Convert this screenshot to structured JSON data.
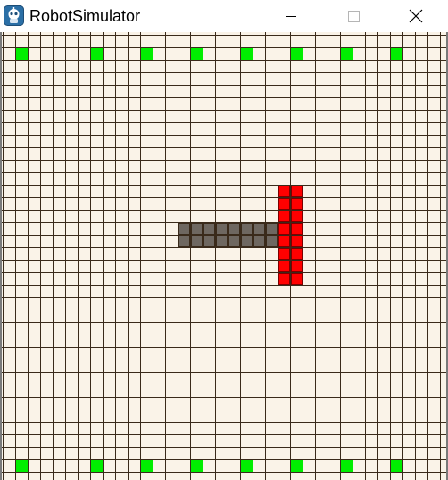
{
  "window": {
    "title": "RobotSimulator",
    "app_icon": "robot-app-icon",
    "controls": [
      "minimize-icon",
      "maximize-icon",
      "close-icon"
    ]
  },
  "colors": {
    "board_background": "#faf3e8",
    "grid_line": "#3a2a1a",
    "marker": "#00ee00",
    "robot_body": "#6e6760",
    "robot_head": "#ff0000"
  },
  "grid": {
    "columns": 36,
    "rows": 36
  },
  "markers": [
    {
      "col": 1,
      "row": 1
    },
    {
      "col": 7,
      "row": 1
    },
    {
      "col": 11,
      "row": 1
    },
    {
      "col": 15,
      "row": 1
    },
    {
      "col": 19,
      "row": 1
    },
    {
      "col": 23,
      "row": 1
    },
    {
      "col": 27,
      "row": 1
    },
    {
      "col": 31,
      "row": 1
    },
    {
      "col": 1,
      "row": 34
    },
    {
      "col": 7,
      "row": 34
    },
    {
      "col": 11,
      "row": 34
    },
    {
      "col": 15,
      "row": 34
    },
    {
      "col": 19,
      "row": 34
    },
    {
      "col": 23,
      "row": 34
    },
    {
      "col": 27,
      "row": 34
    },
    {
      "col": 31,
      "row": 34
    }
  ],
  "robot": {
    "body": {
      "row": 15,
      "cols": [
        14,
        15,
        16,
        17,
        18,
        19,
        20,
        21
      ],
      "rows": 2
    },
    "head": {
      "col_start": 22,
      "col_count": 2,
      "row_start": 12,
      "row_count": 8
    }
  }
}
